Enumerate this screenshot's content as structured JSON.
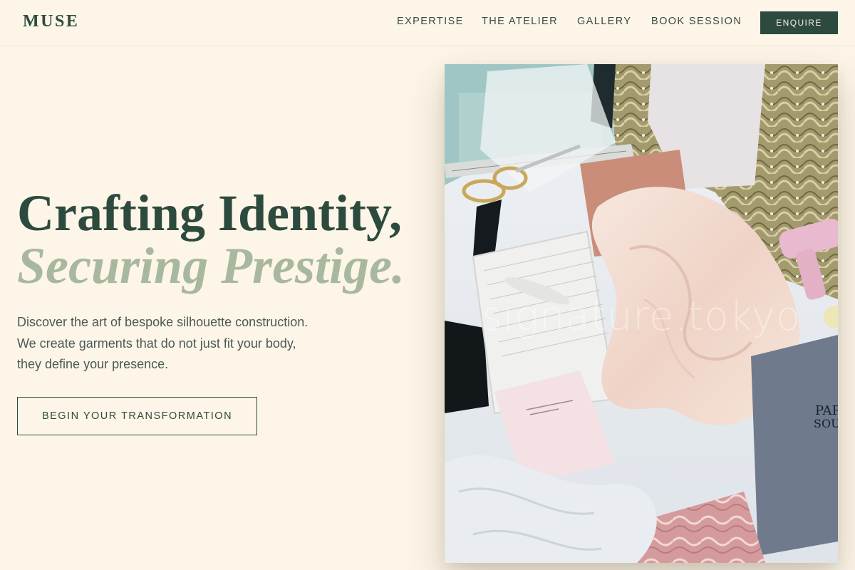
{
  "brand": {
    "name": "MUSE"
  },
  "nav": {
    "items": [
      {
        "label": "EXPERTISE"
      },
      {
        "label": "THE ATELIER"
      },
      {
        "label": "GALLERY"
      },
      {
        "label": "BOOK SESSION"
      }
    ],
    "cta_label": "ENQUIRE"
  },
  "hero": {
    "headline_line1": "Crafting Identity,",
    "headline_line2": "Securing Prestige.",
    "lede_lines": [
      "Discover the art of bespoke silhouette construction.",
      "We create garments that do not just fit your body,",
      "they define your presence."
    ],
    "cta_label": "BEGIN YOUR TRANSFORMATION",
    "image_watermark": "signature.tokyo"
  },
  "colors": {
    "background": "#fdf5e7",
    "primary": "#2d4a3e",
    "accent_sage": "#a8b89e",
    "body_text": "#4a5a55"
  }
}
